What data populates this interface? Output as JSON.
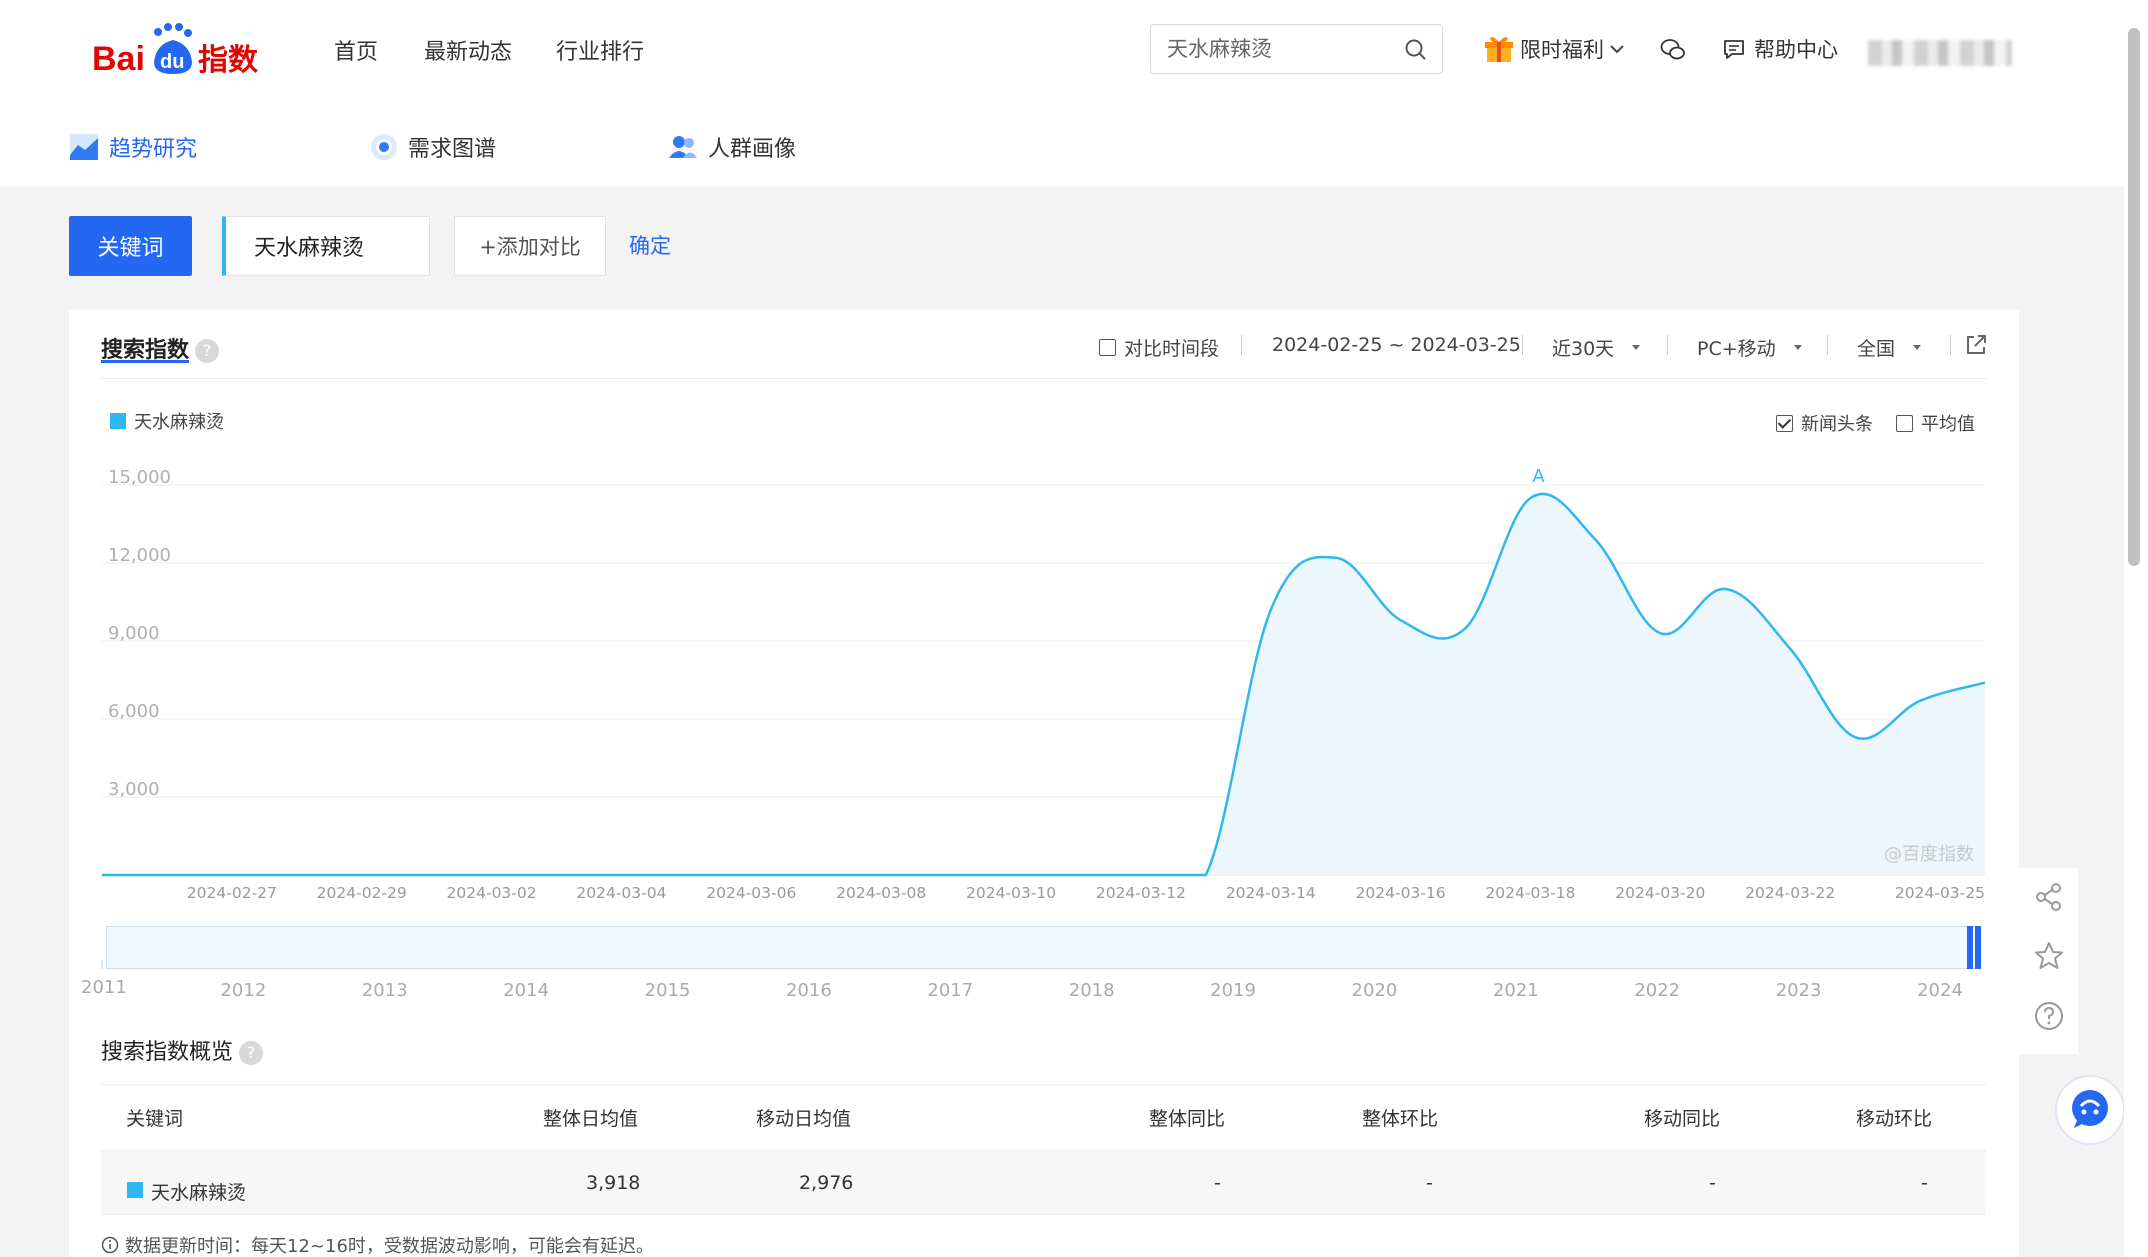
{
  "header": {
    "logo_text": "Baidu指数",
    "nav": [
      "首页",
      "最新动态",
      "行业排行"
    ],
    "search_value": "",
    "search_placeholder": "天水麻辣烫",
    "benefits_label": "限时福利",
    "help_label": "帮助中心"
  },
  "subnav": {
    "tabs": [
      "趋势研究",
      "需求图谱",
      "人群画像"
    ],
    "active_tab": "趋势研究"
  },
  "query_bar": {
    "keyword_button": "关键词",
    "keyword_value": "天水麻辣烫",
    "add_compare": "+添加对比",
    "confirm": "确定"
  },
  "search_index": {
    "title": "搜索指数",
    "compare_period_label": "对比时间段",
    "date_range": "2024-02-25 ~ 2024-03-25",
    "period_select": "近30天",
    "device_select": "PC+移动",
    "region_select": "全国",
    "legend_name": "天水麻辣烫",
    "news_label": "新闻头条",
    "news_checked": true,
    "average_label": "平均值",
    "average_checked": false,
    "watermark": "@百度指数",
    "marker_label": "A"
  },
  "chart_data": {
    "type": "area",
    "series": [
      {
        "name": "天水麻辣烫",
        "color": "#2fb8f0",
        "x": [
          "2024-02-25",
          "2024-02-26",
          "2024-02-27",
          "2024-02-28",
          "2024-02-29",
          "2024-03-01",
          "2024-03-02",
          "2024-03-03",
          "2024-03-04",
          "2024-03-05",
          "2024-03-06",
          "2024-03-07",
          "2024-03-08",
          "2024-03-09",
          "2024-03-10",
          "2024-03-11",
          "2024-03-12",
          "2024-03-13",
          "2024-03-14",
          "2024-03-15",
          "2024-03-16",
          "2024-03-17",
          "2024-03-18",
          "2024-03-19",
          "2024-03-20",
          "2024-03-21",
          "2024-03-22",
          "2024-03-23",
          "2024-03-24",
          "2024-03-25"
        ],
        "values": [
          0,
          0,
          0,
          0,
          0,
          0,
          0,
          0,
          0,
          0,
          0,
          0,
          0,
          0,
          0,
          0,
          0,
          0,
          10200,
          12200,
          9800,
          9500,
          14500,
          12900,
          9300,
          11000,
          8700,
          5300,
          6700,
          7400
        ]
      }
    ],
    "ylim": [
      0,
      15000
    ],
    "yticks": [
      "15,000",
      "12,000",
      "9,000",
      "6,000",
      "3,000"
    ],
    "ytick_values": [
      15000,
      12000,
      9000,
      6000,
      3000
    ],
    "xtick_labels": [
      "2024-02-27",
      "2024-02-29",
      "2024-03-02",
      "2024-03-04",
      "2024-03-06",
      "2024-03-08",
      "2024-03-10",
      "2024-03-12",
      "2024-03-14",
      "2024-03-16",
      "2024-03-18",
      "2024-03-20",
      "2024-03-22",
      "2024-03-25"
    ],
    "grid": true,
    "legend_position": "top-left",
    "annotation": {
      "label": "A",
      "x": "2024-03-18"
    }
  },
  "timeline": {
    "years": [
      "2011",
      "2012",
      "2013",
      "2014",
      "2015",
      "2016",
      "2017",
      "2018",
      "2019",
      "2020",
      "2021",
      "2022",
      "2023",
      "2024"
    ]
  },
  "overview": {
    "title": "搜索指数概览",
    "headers": [
      "关键词",
      "整体日均值",
      "移动日均值",
      "整体同比",
      "整体环比",
      "移动同比",
      "移动环比"
    ],
    "row": {
      "keyword": "天水麻辣烫",
      "overall_avg": "3,918",
      "mobile_avg": "2,976",
      "overall_yoy": "-",
      "overall_mom": "-",
      "mobile_yoy": "-",
      "mobile_mom": "-"
    },
    "footnote": "数据更新时间：每天12~16时，受数据波动影响，可能会有延迟。"
  },
  "colors": {
    "accent": "#2468f2",
    "series": "#2fb8f0",
    "brand_red": "#e10602"
  }
}
